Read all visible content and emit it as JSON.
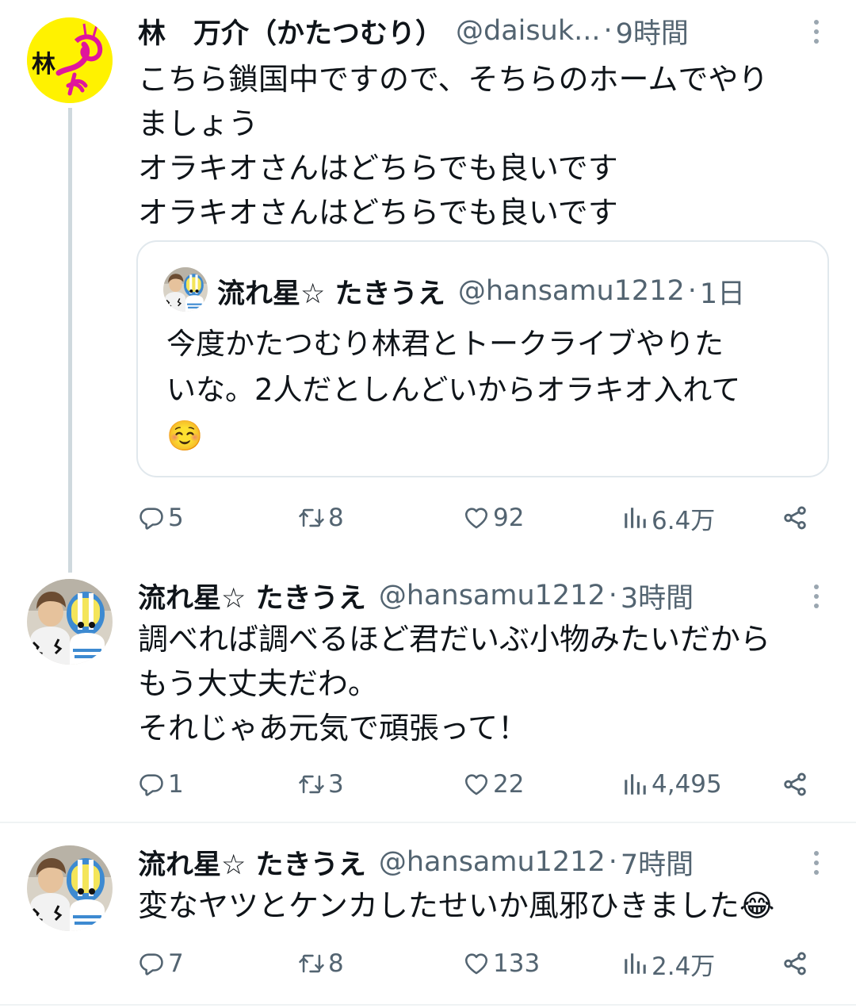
{
  "tweets": [
    {
      "name": "林　万介（かたつむり）",
      "handle": "@daisuk...",
      "dot": "·",
      "time": "9時間",
      "avatar_text": "林",
      "lines": [
        "こちら鎖国中ですので、そちらのホームでやり",
        "ましょう",
        "オラキオさんはどちらでも良いです",
        "オラキオさんはどちらでも良いです"
      ],
      "quote": {
        "name": "流れ星☆ たきうえ",
        "handle": "@hansamu1212",
        "dot": "·",
        "time": "1日",
        "lines": [
          "今度かたつむり林君とトークライブやりた",
          "いな。2人だとしんどいからオラキオ入れて",
          "☺️"
        ]
      },
      "stats": {
        "replies": "5",
        "retweets": "8",
        "likes": "92",
        "views": "6.4万"
      }
    },
    {
      "name": "流れ星☆ たきうえ",
      "handle": "@hansamu1212",
      "dot": "·",
      "time": "3時間",
      "lines": [
        "調べれば調べるほど君だいぶ小物みたいだから",
        "もう大丈夫だわ。",
        "それじゃあ元気で頑張って！"
      ],
      "stats": {
        "replies": "1",
        "retweets": "3",
        "likes": "22",
        "views": "4,495"
      }
    },
    {
      "name": "流れ星☆ たきうえ",
      "handle": "@hansamu1212",
      "dot": "·",
      "time": "7時間",
      "lines": [
        "変なヤツとケンカしたせいか風邪ひきました😂"
      ],
      "stats": {
        "replies": "7",
        "retweets": "8",
        "likes": "133",
        "views": "2.4万"
      }
    }
  ],
  "colors": {
    "text": "#0f1419",
    "muted": "#536471",
    "avatar_yellow": "#fff200",
    "avatar_magenta": "#e0169c",
    "thread_line": "#cfd9de"
  },
  "icons": [
    "reply-icon",
    "retweet-icon",
    "like-icon",
    "views-icon",
    "share-icon",
    "more-icon"
  ]
}
